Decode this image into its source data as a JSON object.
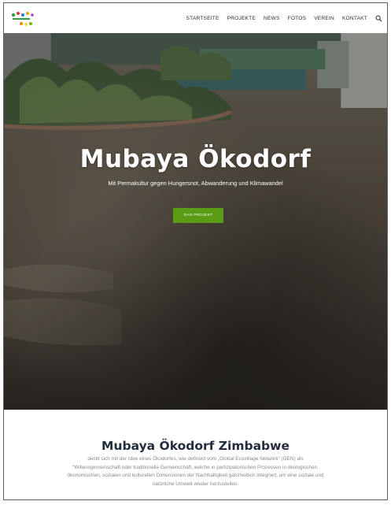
{
  "header": {
    "nav": [
      {
        "label": "STARTSEITE"
      },
      {
        "label": "PROJEKTE"
      },
      {
        "label": "NEWS"
      },
      {
        "label": "FOTOS"
      },
      {
        "label": "VEREIN"
      },
      {
        "label": "KONTAKT"
      }
    ],
    "search_icon": "search-icon",
    "logo_icon": "mubaya-logo"
  },
  "hero": {
    "title": "Mubaya Ökodorf",
    "subtitle": "Mit Permakultur gegen Hungersnot, Abwanderung und Klimawandel",
    "cta_label": "DAS PROJEKT",
    "cta_color": "#5a9c16"
  },
  "section": {
    "title": "Mubaya Ökodorf Zimbabwe",
    "text": "deckt sich mit der Idee eines Ökodorfes, wie definiert vom „Global Ecovillage Network“ (GEN) als \"Willensgemeinschaft oder traditionelle Gemeinschaft, welche in partizipatorischen Prozessen in ökologischen, ökonomischen, sozialen und kulturellen Dimensionen der Nachhaltigkeit ganzheitlich integriert, um eine soziale und natürliche Umwelt wieder herzustellen."
  }
}
